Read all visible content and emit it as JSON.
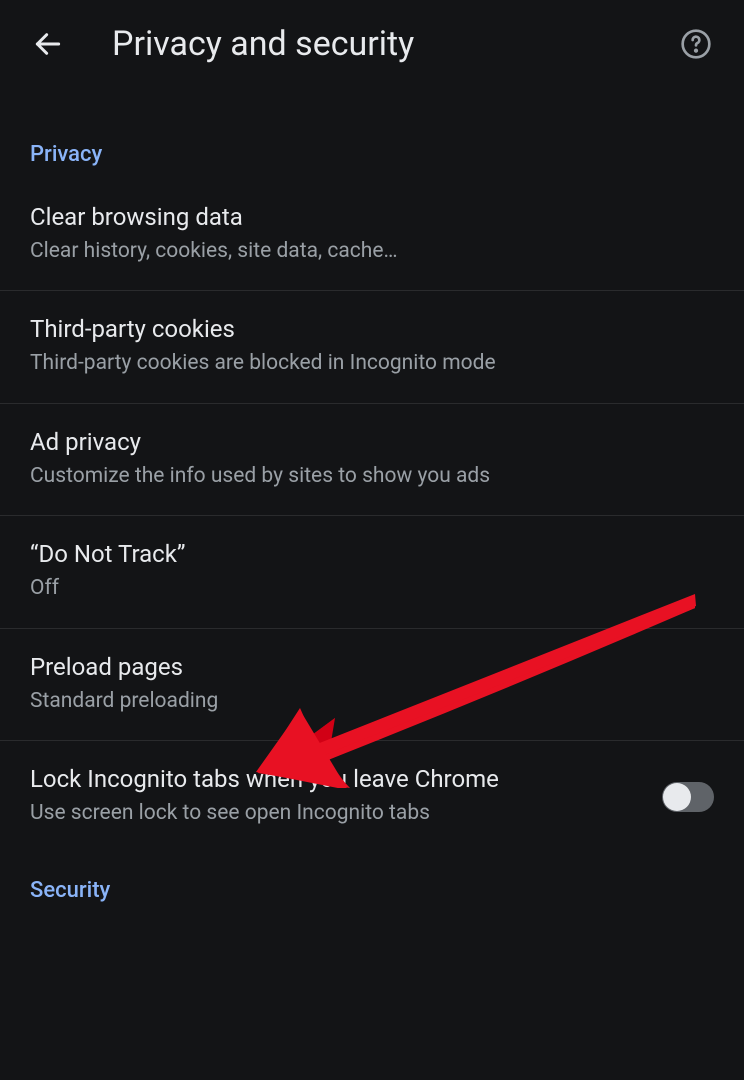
{
  "header": {
    "title": "Privacy and security"
  },
  "sections": {
    "privacy": {
      "label": "Privacy",
      "items": [
        {
          "title": "Clear browsing data",
          "subtitle": "Clear history, cookies, site data, cache…"
        },
        {
          "title": "Third-party cookies",
          "subtitle": "Third-party cookies are blocked in Incognito mode"
        },
        {
          "title": "Ad privacy",
          "subtitle": "Customize the info used by sites to show you ads"
        },
        {
          "title": "“Do Not Track”",
          "subtitle": "Off"
        },
        {
          "title": "Preload pages",
          "subtitle": "Standard preloading"
        },
        {
          "title": "Lock Incognito tabs when you leave Chrome",
          "subtitle": "Use screen lock to see open Incognito tabs"
        }
      ]
    },
    "security": {
      "label": "Security"
    }
  }
}
